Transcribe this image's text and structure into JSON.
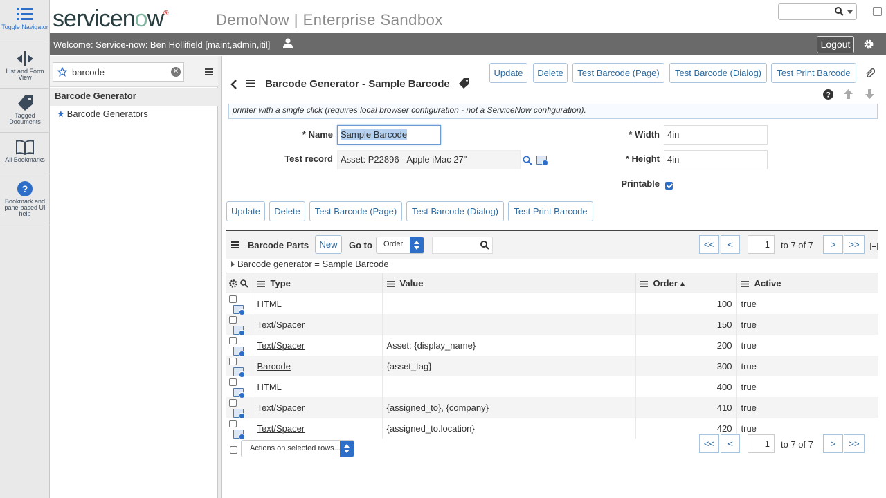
{
  "rail": [
    {
      "label": "Toggle Navigator",
      "icon": "list-icon"
    },
    {
      "label": "List and Form View",
      "icon": "split-arrows-icon"
    },
    {
      "label": "Tagged Documents",
      "icon": "tag-icon"
    },
    {
      "label": "All Bookmarks",
      "icon": "book-icon"
    },
    {
      "label": "Bookmark and pane-based UI help",
      "icon": "question-icon"
    }
  ],
  "header": {
    "logo_text": "servicenow",
    "instance": "DemoNow | Enterprise Sandbox",
    "search_value": ""
  },
  "welcome": {
    "text": "Welcome: Service-now: Ben Hollifield [maint,admin,itil]",
    "logout": "Logout"
  },
  "nav": {
    "filter_value": "barcode",
    "app": "Barcode Generator",
    "module": "Barcode Generators"
  },
  "form": {
    "title": "Barcode Generator - Sample Barcode",
    "buttons": [
      "Update",
      "Delete",
      "Test Barcode (Page)",
      "Test Barcode (Dialog)",
      "Test Print Barcode"
    ],
    "description": "printer with a single click (requires local browser configuration - not a ServiceNow configuration).",
    "fields": {
      "name_label": "Name",
      "name_value": "Sample Barcode",
      "test_record_label": "Test record",
      "test_record_value": "Asset: P22896 - Apple iMac 27\"",
      "width_label": "Width",
      "width_value": "4in",
      "height_label": "Height",
      "height_value": "4in",
      "printable_label": "Printable",
      "printable_checked": true
    }
  },
  "related_list": {
    "title": "Barcode Parts",
    "new_label": "New",
    "goto_label": "Go to",
    "goto_option": "Order",
    "search_value": "",
    "pager": {
      "first": "<<",
      "prev": "<",
      "page": "1",
      "range": "to 7 of 7",
      "next": ">",
      "last": ">>"
    },
    "breadcrumb": "Barcode generator = Sample Barcode",
    "columns": [
      "Type",
      "Value",
      "Order",
      "Active"
    ],
    "rows": [
      {
        "type": "HTML",
        "value": "",
        "order": "100",
        "active": "true"
      },
      {
        "type": "Text/Spacer",
        "value": "",
        "order": "150",
        "active": "true"
      },
      {
        "type": "Text/Spacer",
        "value": "Asset: {display_name}",
        "order": "200",
        "active": "true"
      },
      {
        "type": "Barcode",
        "value": "{asset_tag}",
        "order": "300",
        "active": "true"
      },
      {
        "type": "HTML",
        "value": "",
        "order": "400",
        "active": "true"
      },
      {
        "type": "Text/Spacer",
        "value": "{assigned_to}, {company}",
        "order": "410",
        "active": "true"
      },
      {
        "type": "Text/Spacer",
        "value": "{assigned_to.location}",
        "order": "420",
        "active": "true"
      }
    ],
    "actions_label": "Actions on selected rows..."
  },
  "colors": {
    "accent": "#2d6ec9",
    "button_text": "#2d6aa0",
    "welcome_bar": "#6a6a6a",
    "rail": "#e9e9e9"
  }
}
